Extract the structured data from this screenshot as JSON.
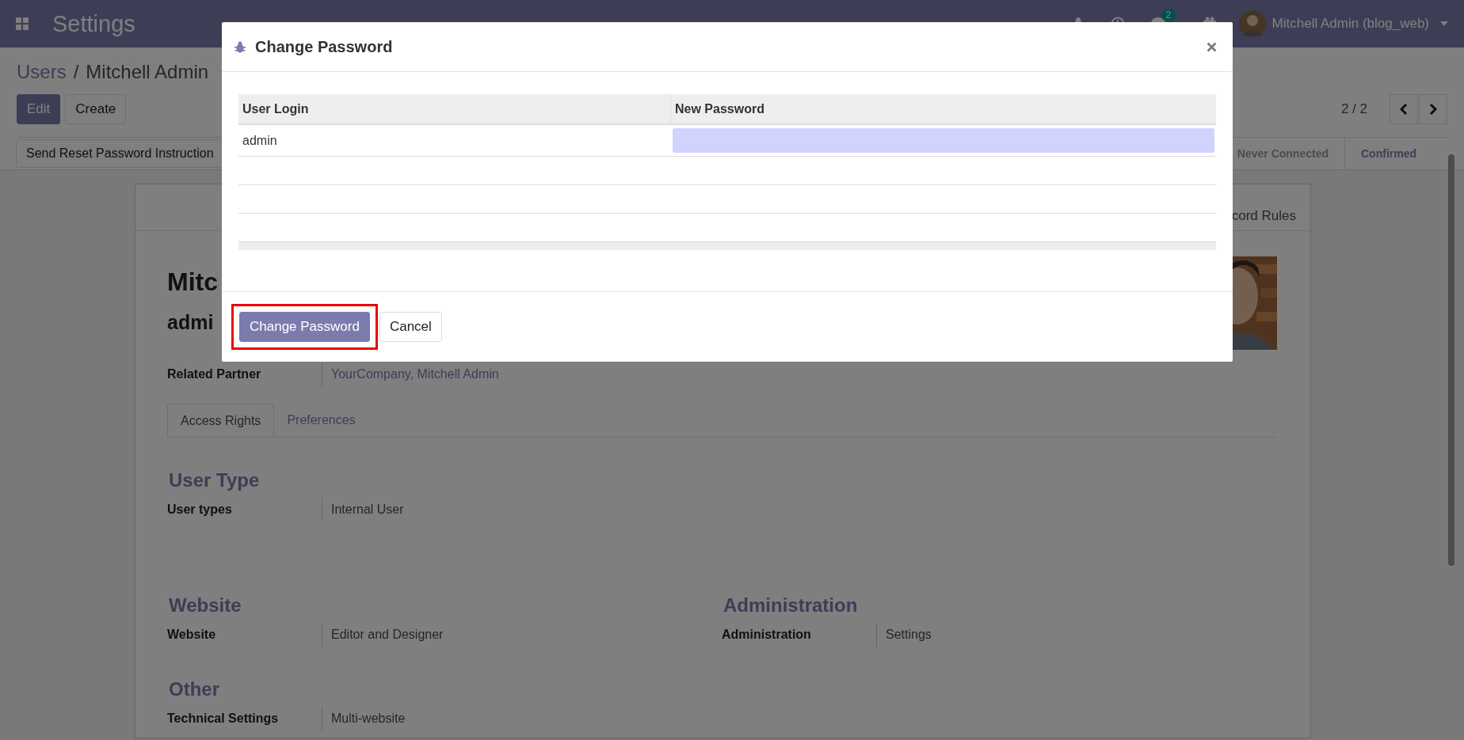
{
  "navbar": {
    "app_title": "Settings",
    "messages_badge": "2",
    "user": "Mitchell Admin (blog_web)"
  },
  "breadcrumb": [
    "Users",
    "Mitchell Admin"
  ],
  "breadcrumb_separator": "/",
  "buttons": [
    {
      "label": "Edit",
      "kind": "primary"
    },
    {
      "label": "Create",
      "kind": "secondary"
    }
  ],
  "pager": "2 / 2",
  "action_button": "Send Reset Password Instruction",
  "statusbar": [
    {
      "label": "Never Connected",
      "selected": false
    },
    {
      "label": "Confirmed",
      "selected": true
    }
  ],
  "sheet": {
    "tab_partial": "cord Rules",
    "name": "Mitc",
    "login": "admi",
    "related_partner": {
      "label": "Related Partner",
      "value": "YourCompany, Mitchell Admin"
    },
    "tabs": [
      {
        "label": "Access Rights",
        "selected": true
      },
      {
        "label": "Preferences",
        "selected": false
      }
    ],
    "rows": [
      [
        {
          "title": "User Type",
          "fields": [
            {
              "label": "User types",
              "value": "Internal User"
            }
          ]
        }
      ],
      [
        {
          "title": "Website",
          "fields": [
            {
              "label": "Website",
              "value": "Editor and Designer"
            }
          ]
        },
        {
          "title": "Administration",
          "fields": [
            {
              "label": "Administration",
              "value": "Settings"
            }
          ]
        }
      ],
      [
        {
          "title": "Other",
          "fields": [
            {
              "label": "Technical Settings",
              "value": "Multi-website"
            }
          ]
        }
      ]
    ]
  },
  "dialog": {
    "title": "Change Password",
    "columns": [
      "User Login",
      "New Password"
    ],
    "rows": [
      {
        "login": "admin"
      }
    ],
    "buttons": [
      {
        "label": "Change Password",
        "kind": "primary",
        "highlighted": true
      },
      {
        "label": "Cancel",
        "kind": "secondary",
        "highlighted": false
      }
    ]
  }
}
